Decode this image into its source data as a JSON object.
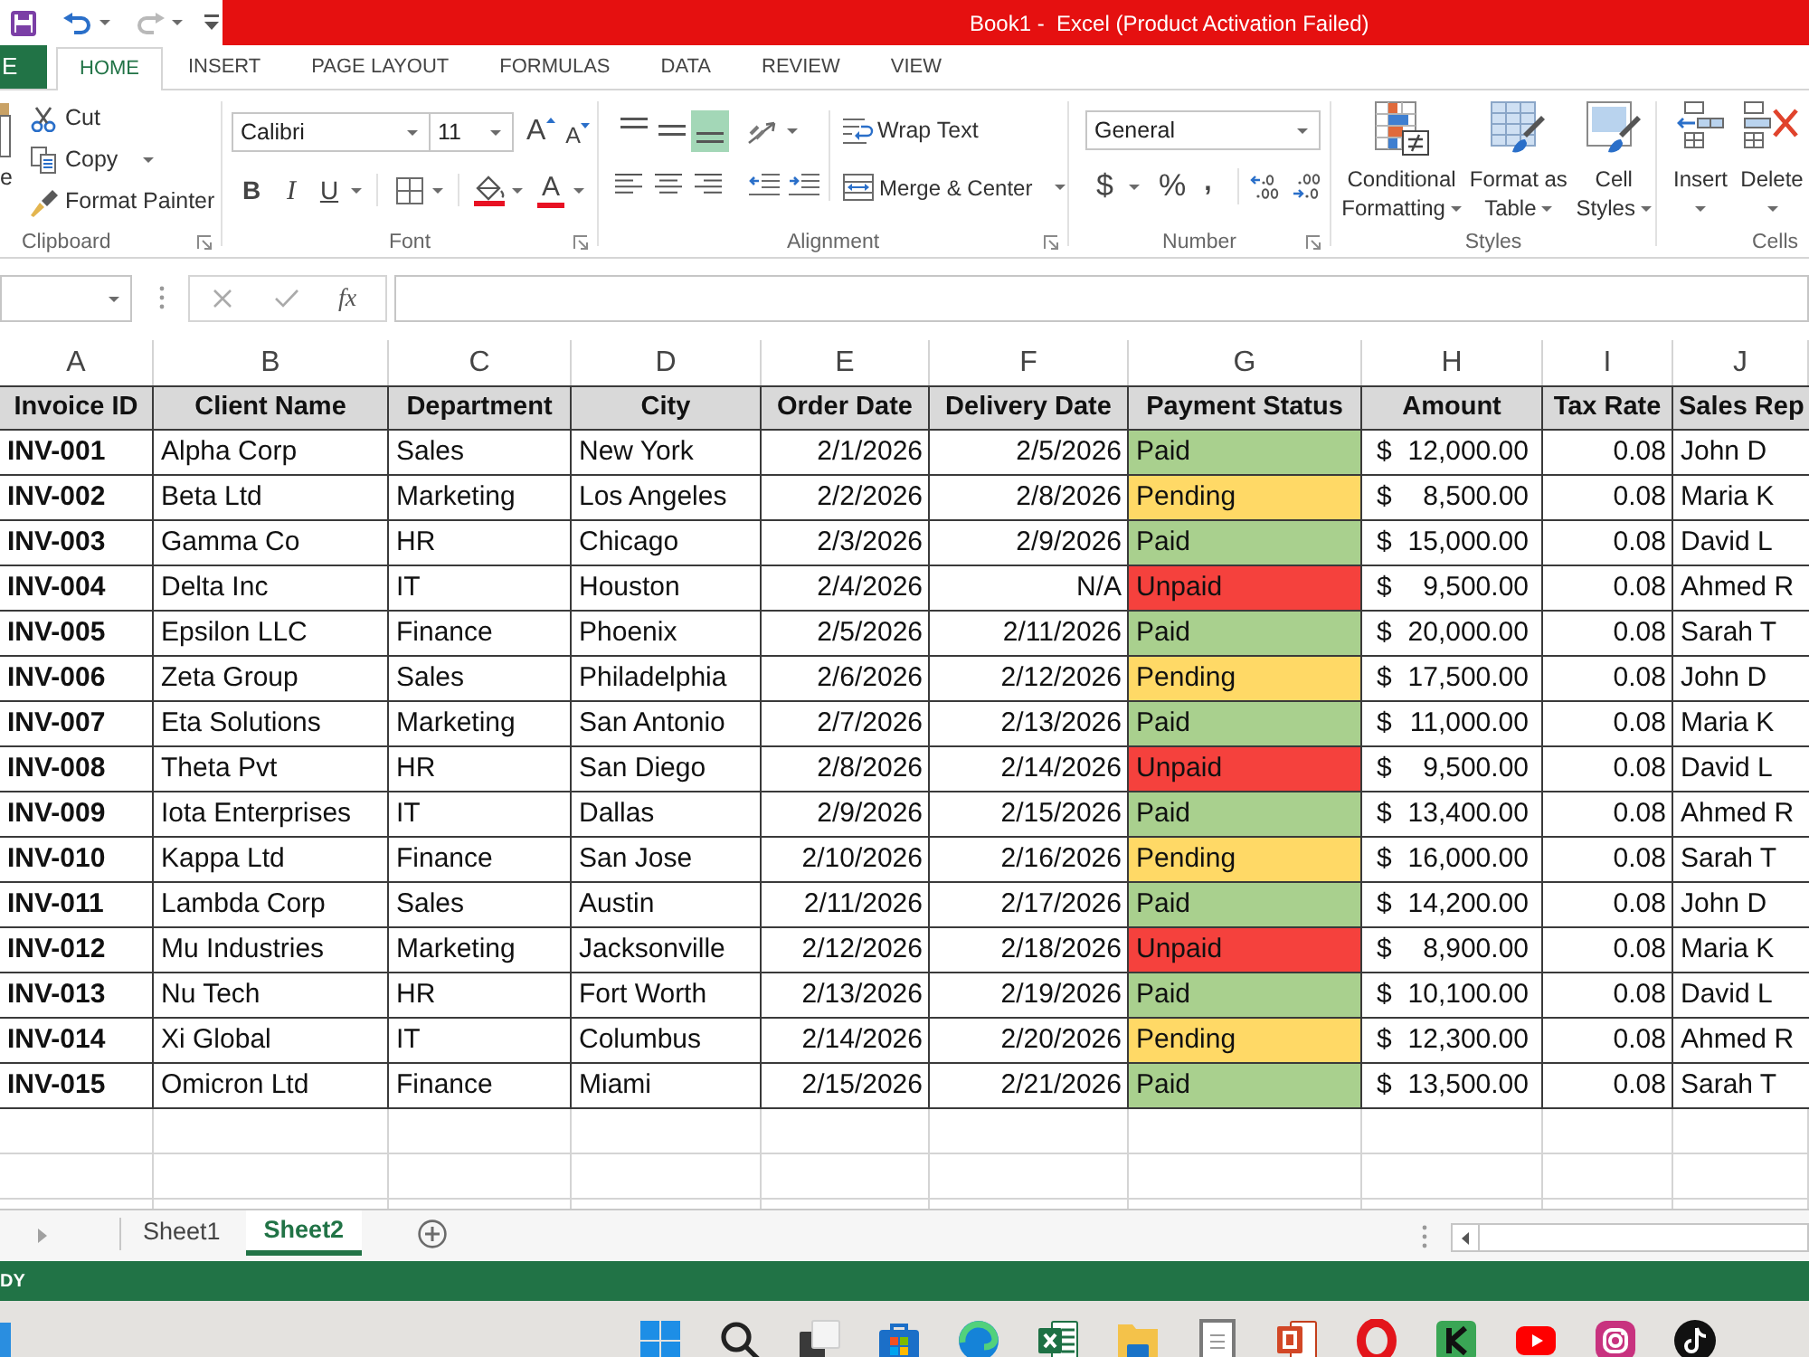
{
  "title_bar": {
    "title": "Book1 -  Excel (Product Activation Failed)"
  },
  "ribbon_tabs": [
    {
      "label": "E",
      "kind": "file",
      "selected": false
    },
    {
      "label": "HOME",
      "kind": "tab",
      "selected": true
    },
    {
      "label": "INSERT",
      "kind": "tab",
      "selected": false
    },
    {
      "label": "PAGE LAYOUT",
      "kind": "tab",
      "selected": false
    },
    {
      "label": "FORMULAS",
      "kind": "tab",
      "selected": false
    },
    {
      "label": "DATA",
      "kind": "tab",
      "selected": false
    },
    {
      "label": "REVIEW",
      "kind": "tab",
      "selected": false
    },
    {
      "label": "VIEW",
      "kind": "tab",
      "selected": false
    }
  ],
  "ribbon": {
    "clipboard": {
      "title": "Clipboard",
      "paste": "e",
      "cut": "Cut",
      "copy": "Copy",
      "format_painter": "Format Painter"
    },
    "font": {
      "title": "Font",
      "font_name": "Calibri",
      "font_size": "11",
      "grow": "A",
      "shrink": "A",
      "bold": "B",
      "italic": "I",
      "underline": "U",
      "font_color": "A"
    },
    "alignment": {
      "title": "Alignment",
      "vertical": [
        {
          "kind": "top",
          "selected": false
        },
        {
          "kind": "middle",
          "selected": false
        },
        {
          "kind": "bottom",
          "selected": true
        }
      ],
      "wrap_text": "Wrap Text",
      "merge": "Merge & Center"
    },
    "number": {
      "title": "Number",
      "format": "General",
      "currency": "$",
      "percent": "%",
      "comma": ","
    },
    "styles": {
      "title": "Styles",
      "buttons": [
        {
          "kind": "conditional",
          "lines": [
            "Conditional",
            "Formatting"
          ]
        },
        {
          "kind": "table",
          "lines": [
            "Format as",
            "Table"
          ]
        },
        {
          "kind": "cell",
          "lines": [
            "Cell",
            "Styles"
          ]
        }
      ]
    },
    "cells": {
      "title": "Cells",
      "buttons": [
        {
          "kind": "insert",
          "label": "Insert"
        },
        {
          "kind": "delete",
          "label": "Delete"
        }
      ]
    }
  },
  "formula_bar": {
    "function": "fx"
  },
  "sheet": {
    "column_letters": [
      "A",
      "B",
      "C",
      "D",
      "E",
      "F",
      "G",
      "H",
      "I",
      "J"
    ],
    "columns": [
      "Invoice ID",
      "Client Name",
      "Department",
      "City",
      "Order Date",
      "Delivery Date",
      "Payment Status",
      "Amount",
      "Tax Rate",
      "Sales Rep"
    ],
    "rows": [
      {
        "id": "INV-001",
        "client": "Alpha Corp",
        "department": "Sales",
        "city": "New York",
        "order_date": "2/1/2026",
        "delivery_date": "2/5/2026",
        "status": "Paid",
        "color": "#a9d08e",
        "currency": "$",
        "amount": "12,000.00",
        "tax_rate": "0.08",
        "sales_rep": "John D"
      },
      {
        "id": "INV-002",
        "client": "Beta Ltd",
        "department": "Marketing",
        "city": "Los Angeles",
        "order_date": "2/2/2026",
        "delivery_date": "2/8/2026",
        "status": "Pending",
        "color": "#ffd966",
        "currency": "$",
        "amount": "8,500.00",
        "tax_rate": "0.08",
        "sales_rep": "Maria K"
      },
      {
        "id": "INV-003",
        "client": "Gamma Co",
        "department": "HR",
        "city": "Chicago",
        "order_date": "2/3/2026",
        "delivery_date": "2/9/2026",
        "status": "Paid",
        "color": "#a9d08e",
        "currency": "$",
        "amount": "15,000.00",
        "tax_rate": "0.08",
        "sales_rep": "David L"
      },
      {
        "id": "INV-004",
        "client": "Delta Inc",
        "department": "IT",
        "city": "Houston",
        "order_date": "2/4/2026",
        "delivery_date": "N/A",
        "status": "Unpaid",
        "color": "#f5413d",
        "currency": "$",
        "amount": "9,500.00",
        "tax_rate": "0.08",
        "sales_rep": "Ahmed R"
      },
      {
        "id": "INV-005",
        "client": "Epsilon LLC",
        "department": "Finance",
        "city": "Phoenix",
        "order_date": "2/5/2026",
        "delivery_date": "2/11/2026",
        "status": "Paid",
        "color": "#a9d08e",
        "currency": "$",
        "amount": "20,000.00",
        "tax_rate": "0.08",
        "sales_rep": "Sarah T"
      },
      {
        "id": "INV-006",
        "client": "Zeta Group",
        "department": "Sales",
        "city": "Philadelphia",
        "order_date": "2/6/2026",
        "delivery_date": "2/12/2026",
        "status": "Pending",
        "color": "#ffd966",
        "currency": "$",
        "amount": "17,500.00",
        "tax_rate": "0.08",
        "sales_rep": "John D"
      },
      {
        "id": "INV-007",
        "client": "Eta Solutions",
        "department": "Marketing",
        "city": "San Antonio",
        "order_date": "2/7/2026",
        "delivery_date": "2/13/2026",
        "status": "Paid",
        "color": "#a9d08e",
        "currency": "$",
        "amount": "11,000.00",
        "tax_rate": "0.08",
        "sales_rep": "Maria K"
      },
      {
        "id": "INV-008",
        "client": "Theta Pvt",
        "department": "HR",
        "city": "San Diego",
        "order_date": "2/8/2026",
        "delivery_date": "2/14/2026",
        "status": "Unpaid",
        "color": "#f5413d",
        "currency": "$",
        "amount": "9,500.00",
        "tax_rate": "0.08",
        "sales_rep": "David L"
      },
      {
        "id": "INV-009",
        "client": "Iota Enterprises",
        "department": "IT",
        "city": "Dallas",
        "order_date": "2/9/2026",
        "delivery_date": "2/15/2026",
        "status": "Paid",
        "color": "#a9d08e",
        "currency": "$",
        "amount": "13,400.00",
        "tax_rate": "0.08",
        "sales_rep": "Ahmed R"
      },
      {
        "id": "INV-010",
        "client": "Kappa Ltd",
        "department": "Finance",
        "city": "San Jose",
        "order_date": "2/10/2026",
        "delivery_date": "2/16/2026",
        "status": "Pending",
        "color": "#ffd966",
        "currency": "$",
        "amount": "16,000.00",
        "tax_rate": "0.08",
        "sales_rep": "Sarah T"
      },
      {
        "id": "INV-011",
        "client": "Lambda Corp",
        "department": "Sales",
        "city": "Austin",
        "order_date": "2/11/2026",
        "delivery_date": "2/17/2026",
        "status": "Paid",
        "color": "#a9d08e",
        "currency": "$",
        "amount": "14,200.00",
        "tax_rate": "0.08",
        "sales_rep": "John D"
      },
      {
        "id": "INV-012",
        "client": "Mu Industries",
        "department": "Marketing",
        "city": "Jacksonville",
        "order_date": "2/12/2026",
        "delivery_date": "2/18/2026",
        "status": "Unpaid",
        "color": "#f5413d",
        "currency": "$",
        "amount": "8,900.00",
        "tax_rate": "0.08",
        "sales_rep": "Maria K"
      },
      {
        "id": "INV-013",
        "client": "Nu Tech",
        "department": "HR",
        "city": "Fort Worth",
        "order_date": "2/13/2026",
        "delivery_date": "2/19/2026",
        "status": "Paid",
        "color": "#a9d08e",
        "currency": "$",
        "amount": "10,100.00",
        "tax_rate": "0.08",
        "sales_rep": "David L"
      },
      {
        "id": "INV-014",
        "client": "Xi Global",
        "department": "IT",
        "city": "Columbus",
        "order_date": "2/14/2026",
        "delivery_date": "2/20/2026",
        "status": "Pending",
        "color": "#ffd966",
        "currency": "$",
        "amount": "12,300.00",
        "tax_rate": "0.08",
        "sales_rep": "Ahmed R"
      },
      {
        "id": "INV-015",
        "client": "Omicron Ltd",
        "department": "Finance",
        "city": "Miami",
        "order_date": "2/15/2026",
        "delivery_date": "2/21/2026",
        "status": "Paid",
        "color": "#a9d08e",
        "currency": "$",
        "amount": "13,500.00",
        "tax_rate": "0.08",
        "sales_rep": "Sarah T"
      }
    ]
  },
  "sheet_tabs": [
    {
      "label": "Sheet1",
      "selected": false
    },
    {
      "label": "Sheet2",
      "selected": true
    }
  ],
  "status_bar": {
    "text": "DY"
  }
}
